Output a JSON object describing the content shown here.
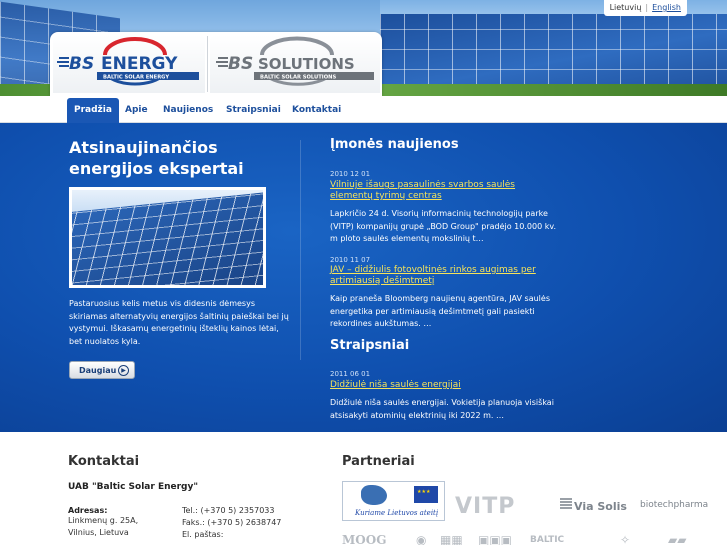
{
  "header": {
    "logo_energy": {
      "mark": "BS",
      "word": "ENERGY",
      "tagline": "BALTIC SOLAR ENERGY"
    },
    "logo_solutions": {
      "mark": "BS",
      "word": "SOLUTIONS",
      "tagline": "BALTIC SOLAR SOLUTIONS"
    },
    "languages": [
      "Lietuvių",
      "English"
    ]
  },
  "nav": {
    "items": [
      "Pradžia",
      "Apie",
      "Naujienos",
      "Straipsniai",
      "Kontaktai"
    ],
    "active_index": 0
  },
  "hero": {
    "title": "Atsinaujinančios energijos ekspertai",
    "text": "Pastaruosius kelis metus vis didesnis dėmesys skiriamas alternatyvių energijos šaltinių paieškai bei jų vystymui. Iškasamų energetinių išteklių kainos lėtai, bet nuolatos kyla.",
    "button": "Daugiau",
    "button_icon": "arrow-right-circle-icon"
  },
  "news": {
    "title": "Įmonės naujienos",
    "items": [
      {
        "date": "2010 12 01",
        "link": "Vilniuje išaugs pasaulinės svarbos saulės elementų tyrimų centras",
        "text": "Lapkričio 24 d. Visorių informacinių technologijų parke (VITP) kompanijų grupė „BOD Group\" pradėjo 10.000 kv. m ploto saulės elementų mokslinių t…"
      },
      {
        "date": "2010 11 07",
        "link": "JAV – didžiulis fotovoltinės rinkos augimas per artimiausią dešimtmetį",
        "text": "Kaip praneša Bloomberg naujienų agentūra, JAV saulės energetika per artimiausią dešimtmetį gali pasiekti rekordines aukštumas. …"
      }
    ]
  },
  "articles": {
    "title": "Straipsniai",
    "items": [
      {
        "date": "2011 06 01",
        "link": "Didžiulė niša saulės energijai",
        "text": "Didžiulė niša saulės energijai. Vokietija planuoja visiškai atsisakyti atominių elektrinių iki 2022 m. …"
      }
    ]
  },
  "contacts": {
    "title": "Kontaktai",
    "company": "UAB \"Baltic Solar Energy\"",
    "address_label": "Adresas:",
    "address": [
      "Linkmenų g. 25A,",
      "Vilnius, Lietuva"
    ],
    "phone": "Tel.: (+370 5) 2357033",
    "fax": "Faks.: (+370 5) 2638747",
    "email_label": "El. paštas:"
  },
  "partners": {
    "title": "Partneriai",
    "eu_slogan": "Kuriame Lietuvos ateitį",
    "vitp": "VITP",
    "viasolis": "Via Solis",
    "biotech": "biotechpharma",
    "baltic": "BALTIC"
  },
  "colors": {
    "brand_blue": "#1a57b4",
    "band_blue": "#0f4fae",
    "link_yellow": "#f5e35a",
    "logo_red": "#d8262e"
  }
}
